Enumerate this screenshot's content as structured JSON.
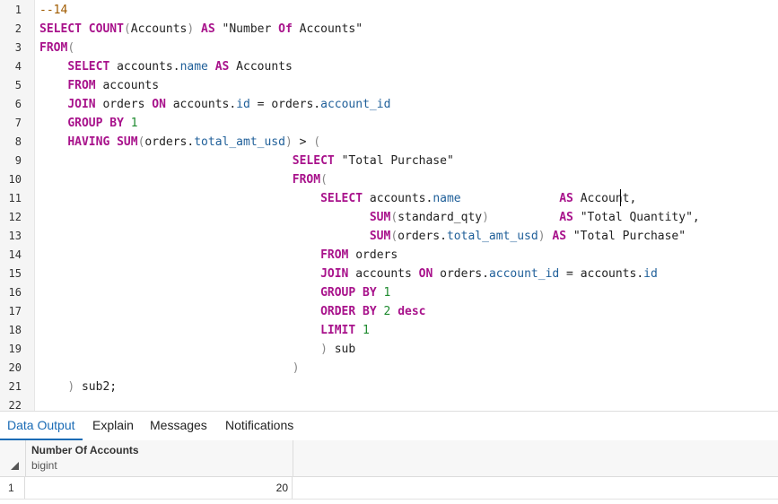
{
  "editor": {
    "line_numbers": [
      "1",
      "2",
      "3",
      "4",
      "5",
      "6",
      "7",
      "8",
      "9",
      "10",
      "11",
      "12",
      "13",
      "14",
      "15",
      "16",
      "17",
      "18",
      "19",
      "20",
      "21",
      "22"
    ],
    "lines": [
      [
        [
          "comment",
          "--14"
        ]
      ],
      [
        [
          "kw",
          "SELECT"
        ],
        [
          "plain",
          " "
        ],
        [
          "kw",
          "COUNT"
        ],
        [
          "punct",
          "("
        ],
        [
          "plain",
          "Accounts"
        ],
        [
          "punct",
          ")"
        ],
        [
          "plain",
          " "
        ],
        [
          "kw",
          "AS"
        ],
        [
          "plain",
          " "
        ],
        [
          "str",
          "\"Number "
        ],
        [
          "kw",
          "Of"
        ],
        [
          "str",
          " Accounts\""
        ]
      ],
      [
        [
          "kw",
          "FROM"
        ],
        [
          "punct",
          "("
        ]
      ],
      [
        [
          "plain",
          "    "
        ],
        [
          "kw",
          "SELECT"
        ],
        [
          "plain",
          " accounts."
        ],
        [
          "field",
          "name"
        ],
        [
          "plain",
          " "
        ],
        [
          "kw",
          "AS"
        ],
        [
          "plain",
          " Accounts"
        ]
      ],
      [
        [
          "plain",
          "    "
        ],
        [
          "kw",
          "FROM"
        ],
        [
          "plain",
          " accounts"
        ]
      ],
      [
        [
          "plain",
          "    "
        ],
        [
          "kw",
          "JOIN"
        ],
        [
          "plain",
          " orders "
        ],
        [
          "kw",
          "ON"
        ],
        [
          "plain",
          " accounts."
        ],
        [
          "field",
          "id"
        ],
        [
          "plain",
          " = orders."
        ],
        [
          "field",
          "account_id"
        ]
      ],
      [
        [
          "plain",
          "    "
        ],
        [
          "kw",
          "GROUP BY"
        ],
        [
          "plain",
          " "
        ],
        [
          "num",
          "1"
        ]
      ],
      [
        [
          "plain",
          "    "
        ],
        [
          "kw",
          "HAVING"
        ],
        [
          "plain",
          " "
        ],
        [
          "kw",
          "SUM"
        ],
        [
          "punct",
          "("
        ],
        [
          "plain",
          "orders."
        ],
        [
          "field",
          "total_amt_usd"
        ],
        [
          "punct",
          ")"
        ],
        [
          "plain",
          " > "
        ],
        [
          "punct",
          "("
        ]
      ],
      [
        [
          "plain",
          "                                    "
        ],
        [
          "kw",
          "SELECT"
        ],
        [
          "plain",
          " "
        ],
        [
          "str",
          "\"Total Purchase\""
        ]
      ],
      [
        [
          "plain",
          "                                    "
        ],
        [
          "kw",
          "FROM"
        ],
        [
          "punct",
          "("
        ]
      ],
      [
        [
          "plain",
          "                                        "
        ],
        [
          "kw",
          "SELECT"
        ],
        [
          "plain",
          " accounts."
        ],
        [
          "field",
          "name"
        ],
        [
          "plain",
          "              "
        ],
        [
          "kw",
          "AS"
        ],
        [
          "plain",
          " Account,"
        ]
      ],
      [
        [
          "plain",
          "                                               "
        ],
        [
          "kw",
          "SUM"
        ],
        [
          "punct",
          "("
        ],
        [
          "plain",
          "standard_qty"
        ],
        [
          "punct",
          ")"
        ],
        [
          "plain",
          "          "
        ],
        [
          "kw",
          "AS"
        ],
        [
          "plain",
          " "
        ],
        [
          "str",
          "\"Total Quantity\","
        ]
      ],
      [
        [
          "plain",
          "                                               "
        ],
        [
          "kw",
          "SUM"
        ],
        [
          "punct",
          "("
        ],
        [
          "plain",
          "orders."
        ],
        [
          "field",
          "total_amt_usd"
        ],
        [
          "punct",
          ")"
        ],
        [
          "plain",
          " "
        ],
        [
          "kw",
          "AS"
        ],
        [
          "plain",
          " "
        ],
        [
          "str",
          "\"Total Purchase\""
        ]
      ],
      [
        [
          "plain",
          "                                        "
        ],
        [
          "kw",
          "FROM"
        ],
        [
          "plain",
          " orders"
        ]
      ],
      [
        [
          "plain",
          "                                        "
        ],
        [
          "kw",
          "JOIN"
        ],
        [
          "plain",
          " accounts "
        ],
        [
          "kw",
          "ON"
        ],
        [
          "plain",
          " orders."
        ],
        [
          "field",
          "account_id"
        ],
        [
          "plain",
          " = accounts."
        ],
        [
          "field",
          "id"
        ]
      ],
      [
        [
          "plain",
          "                                        "
        ],
        [
          "kw",
          "GROUP BY"
        ],
        [
          "plain",
          " "
        ],
        [
          "num",
          "1"
        ]
      ],
      [
        [
          "plain",
          "                                        "
        ],
        [
          "kw",
          "ORDER BY"
        ],
        [
          "plain",
          " "
        ],
        [
          "num",
          "2"
        ],
        [
          "plain",
          " "
        ],
        [
          "kw",
          "desc"
        ]
      ],
      [
        [
          "plain",
          "                                        "
        ],
        [
          "kw",
          "LIMIT"
        ],
        [
          "plain",
          " "
        ],
        [
          "num",
          "1"
        ]
      ],
      [
        [
          "plain",
          "                                        "
        ],
        [
          "punct",
          ")"
        ],
        [
          "plain",
          " sub"
        ]
      ],
      [
        [
          "plain",
          "                                    "
        ],
        [
          "punct",
          ")"
        ]
      ],
      [
        [
          "plain",
          "    "
        ],
        [
          "punct",
          ")"
        ],
        [
          "plain",
          " sub2;"
        ]
      ],
      []
    ]
  },
  "tabs": [
    {
      "label": "Data Output",
      "active": true
    },
    {
      "label": "Explain",
      "active": false
    },
    {
      "label": "Messages",
      "active": false
    },
    {
      "label": "Notifications",
      "active": false
    }
  ],
  "grid": {
    "column": {
      "name": "Number Of Accounts",
      "type": "bigint"
    },
    "rows": [
      {
        "row_number": "1",
        "value": "20"
      }
    ]
  },
  "colors": {
    "keyword": "#a8128b",
    "field": "#1f5f99",
    "number": "#1d8a2e",
    "comment": "#a05b00",
    "active_tab": "#1a6bb5"
  }
}
